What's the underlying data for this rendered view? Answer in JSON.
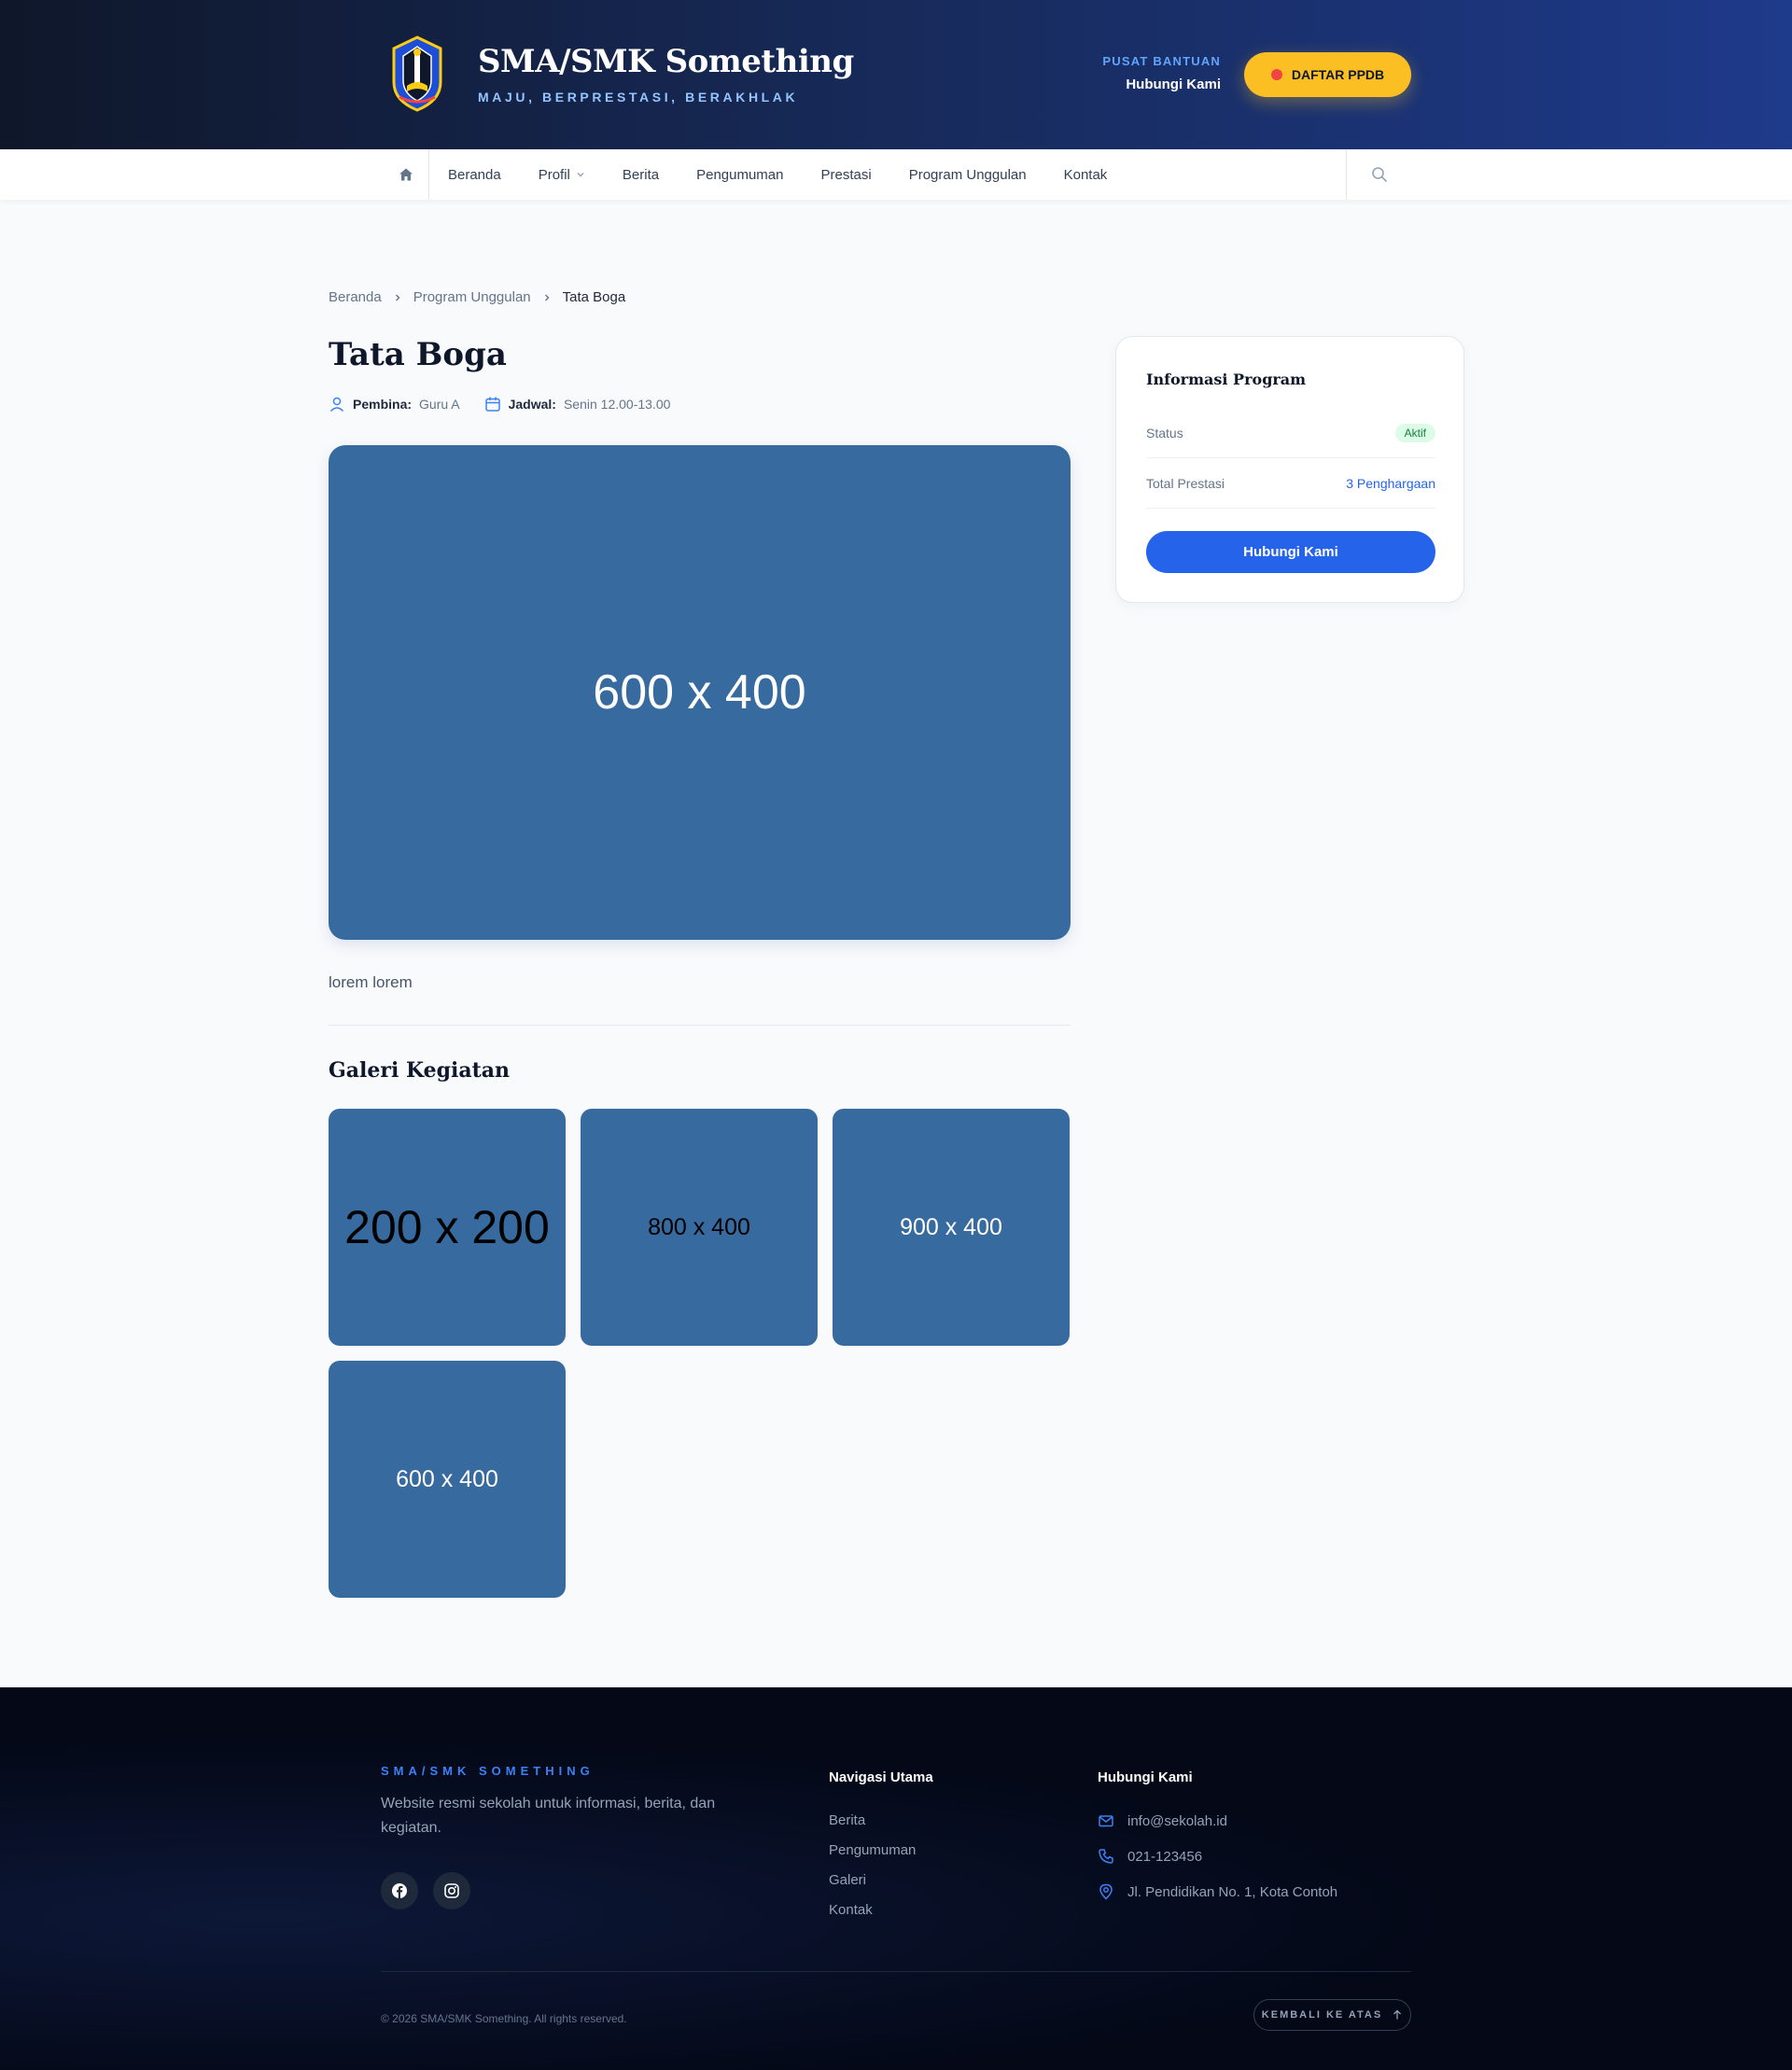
{
  "header": {
    "brand_name": "SMA/SMK Something",
    "tagline": "MAJU, BERPRESTASI, BERAKHLAK",
    "help_label": "PUSAT BANTUAN",
    "help_link": "Hubungi Kami",
    "cta_label": "DAFTAR PPDB"
  },
  "nav": {
    "items": [
      {
        "label": "Beranda"
      },
      {
        "label": "Profil"
      },
      {
        "label": "Berita"
      },
      {
        "label": "Pengumuman"
      },
      {
        "label": "Prestasi"
      },
      {
        "label": "Program Unggulan"
      },
      {
        "label": "Kontak"
      }
    ]
  },
  "breadcrumb": [
    "Beranda",
    "Program Unggulan",
    "Tata Boga"
  ],
  "page": {
    "title": "Tata Boga",
    "pembina_label": "Pembina:",
    "pembina_value": "Guru A",
    "jadwal_label": "Jadwal:",
    "jadwal_value": "Senin 12.00-13.00",
    "hero_placeholder": "600 x 400",
    "description": "lorem lorem",
    "gallery_title": "Galeri Kegiatan",
    "gallery": [
      {
        "label": "200 x 200",
        "text_color": "#000000"
      },
      {
        "label": "800 x 400",
        "text_color": "#000000"
      },
      {
        "label": "900 x 400",
        "text_color": "#ffffff"
      },
      {
        "label": "600 x 400",
        "text_color": "#ffffff"
      }
    ]
  },
  "info_card": {
    "title": "Informasi Program",
    "status_label": "Status",
    "status_value": "Aktif",
    "prestasi_label": "Total Prestasi",
    "prestasi_value": "3 Penghargaan",
    "button": "Hubungi Kami"
  },
  "footer": {
    "brand": "SMA/SMK SOMETHING",
    "description": "Website resmi sekolah untuk informasi, berita, dan kegiatan.",
    "nav_title": "Navigasi Utama",
    "nav_links": [
      "Berita",
      "Pengumuman",
      "Galeri",
      "Kontak"
    ],
    "contact_title": "Hubungi Kami",
    "email": "info@sekolah.id",
    "phone": "021-123456",
    "address": "Jl. Pendidikan No. 1, Kota Contoh",
    "copyright": "© 2026 SMA/SMK Something. All rights reserved.",
    "back_to_top": "KEMBALI KE ATAS"
  },
  "colors": {
    "header_gradient_start": "#0f172a",
    "header_gradient_end": "#1e3a8a",
    "cta": "#fbbf24",
    "primary": "#2563eb",
    "placeholder": "#376a9f",
    "footer_bg": "#040817"
  },
  "icons": {
    "nav_home": "home-icon",
    "nav_search": "search-icon",
    "pembina": "user-icon",
    "jadwal": "calendar-icon",
    "breadcrumb_sep": "chevron-right-icon",
    "social": [
      "facebook-icon",
      "instagram-icon"
    ],
    "contact": [
      "mail-icon",
      "phone-icon",
      "map-pin-icon"
    ],
    "back_to_top": "arrow-up-icon"
  }
}
